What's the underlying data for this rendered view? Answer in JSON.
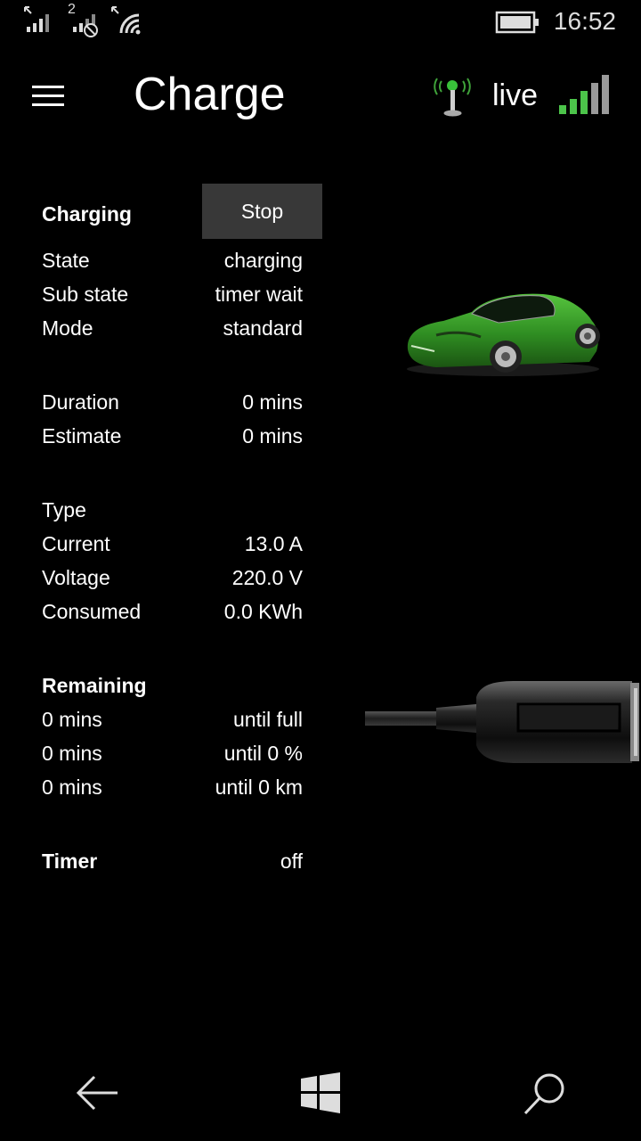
{
  "status_bar": {
    "time": "16:52",
    "sim2_label": "2"
  },
  "header": {
    "title": "Charge",
    "live_label": "live"
  },
  "charging": {
    "heading": "Charging",
    "stop_label": "Stop"
  },
  "rows": {
    "state": {
      "label": "State",
      "value": "charging"
    },
    "sub_state": {
      "label": "Sub state",
      "value": "timer wait"
    },
    "mode": {
      "label": "Mode",
      "value": "standard"
    },
    "duration": {
      "label": "Duration",
      "value": "0 mins"
    },
    "estimate": {
      "label": "Estimate",
      "value": "0 mins"
    },
    "type": {
      "label": "Type",
      "value": ""
    },
    "current": {
      "label": "Current",
      "value": "13.0 A"
    },
    "voltage": {
      "label": "Voltage",
      "value": "220.0 V"
    },
    "consumed": {
      "label": "Consumed",
      "value": "0.0 KWh"
    }
  },
  "remaining": {
    "heading": "Remaining",
    "items": [
      {
        "label": "0 mins",
        "value": "until full"
      },
      {
        "label": "0 mins",
        "value": "until 0 %"
      },
      {
        "label": "0 mins",
        "value": "until 0 km"
      }
    ]
  },
  "timer": {
    "label": "Timer",
    "value": "off"
  },
  "colors": {
    "accent_green": "#3fa33a",
    "button_bg": "#383838"
  },
  "icons": [
    "signal-icon",
    "sim2-signal-icon",
    "no-sim-icon",
    "wifi-icon",
    "battery-icon",
    "hamburger-icon",
    "antenna-icon",
    "signal-strength-icon",
    "car-image",
    "charger-plug-image",
    "back-icon",
    "windows-icon",
    "search-icon"
  ]
}
